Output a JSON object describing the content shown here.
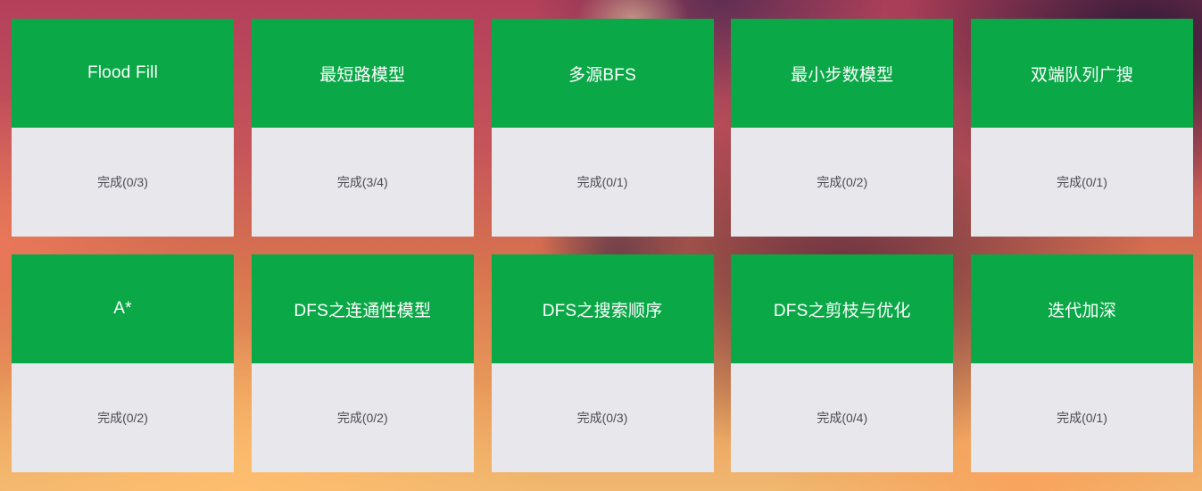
{
  "cards": [
    {
      "title": "Flood Fill",
      "status": "完成(0/3)"
    },
    {
      "title": "最短路模型",
      "status": "完成(3/4)"
    },
    {
      "title": "多源BFS",
      "status": "完成(0/1)"
    },
    {
      "title": "最小步数模型",
      "status": "完成(0/2)"
    },
    {
      "title": "双端队列广搜",
      "status": "完成(0/1)"
    },
    {
      "title": "A*",
      "status": "完成(0/2)"
    },
    {
      "title": "DFS之连通性模型",
      "status": "完成(0/2)"
    },
    {
      "title": "DFS之搜索顺序",
      "status": "完成(0/3)"
    },
    {
      "title": "DFS之剪枝与优化",
      "status": "完成(0/4)"
    },
    {
      "title": "迭代加深",
      "status": "完成(0/1)"
    }
  ],
  "colors": {
    "card_header": "#0aa847",
    "card_body": "#e8e8ec"
  }
}
